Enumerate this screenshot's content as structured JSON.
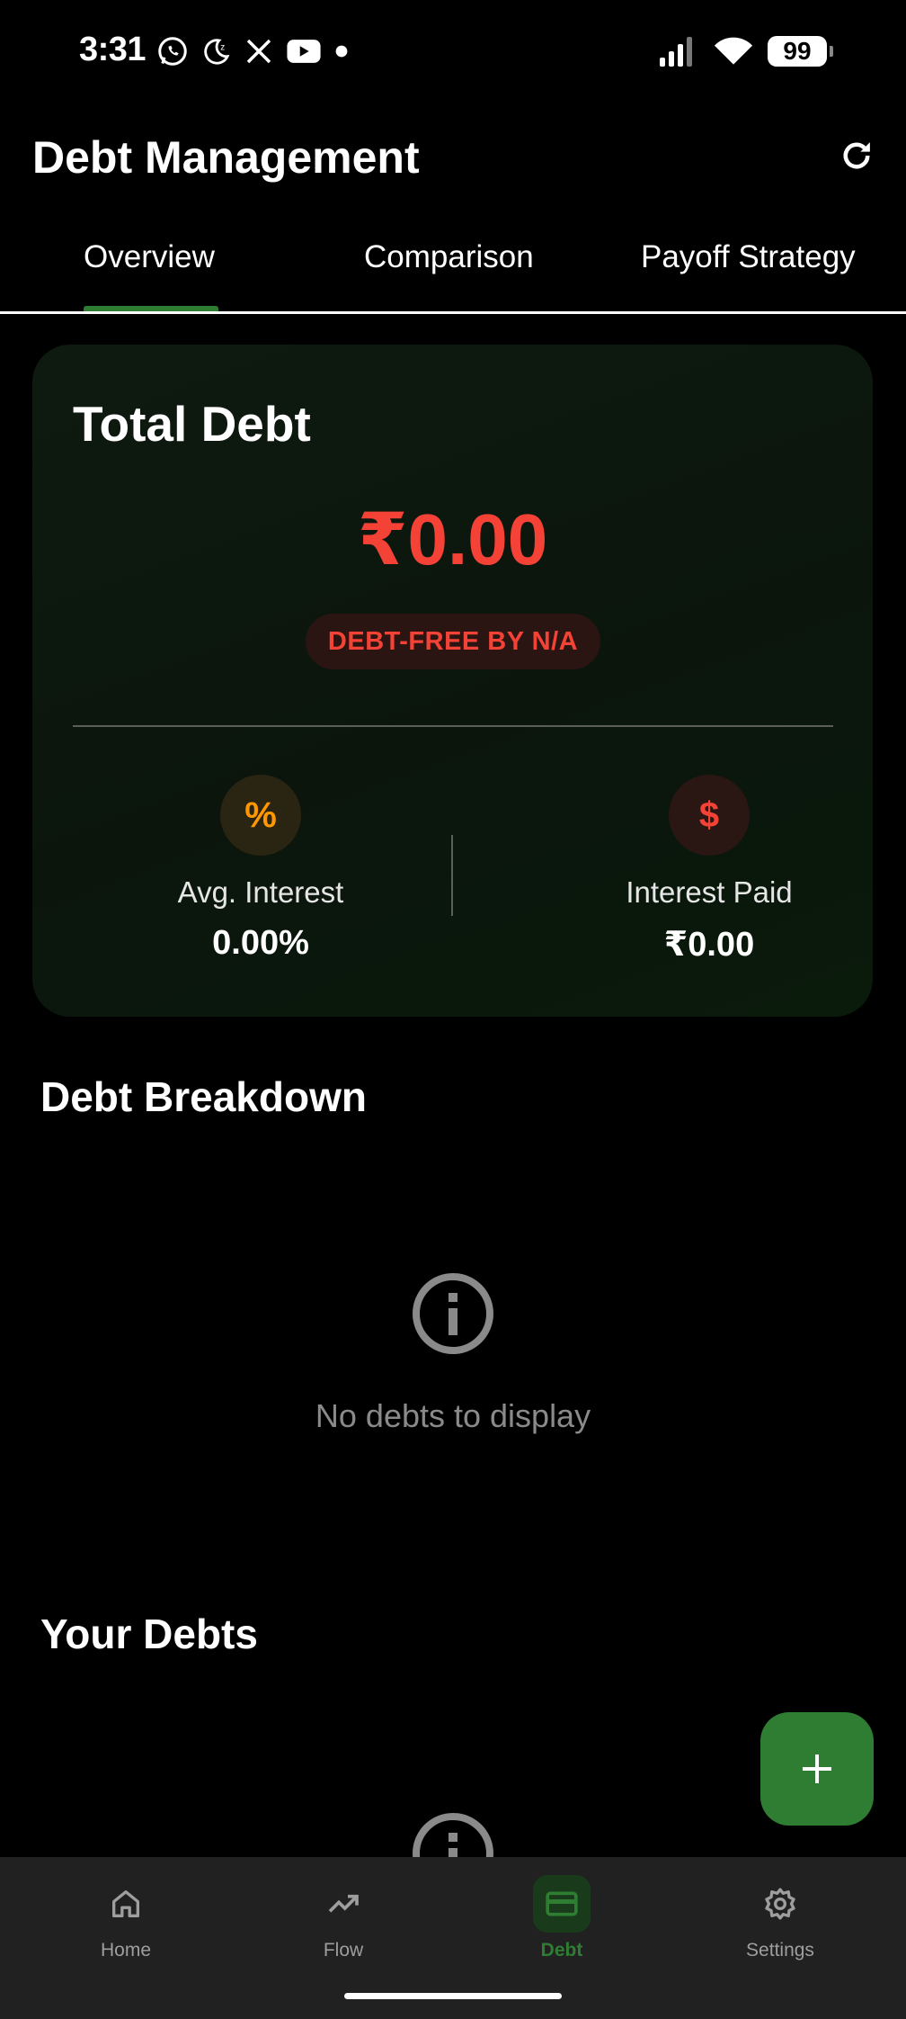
{
  "status_bar": {
    "time": "3:31",
    "battery": "99",
    "icons": [
      "whatsapp-icon",
      "do-not-disturb-icon",
      "x-icon",
      "youtube-icon",
      "dot-icon",
      "signal-icon",
      "wifi-icon",
      "battery-icon"
    ]
  },
  "header": {
    "title": "Debt Management",
    "refresh_icon": "refresh-icon"
  },
  "tabs": [
    {
      "label": "Overview",
      "active": true
    },
    {
      "label": "Comparison",
      "active": false
    },
    {
      "label": "Payoff Strategy",
      "active": false
    }
  ],
  "summary": {
    "title": "Total Debt",
    "total": "₹0.00",
    "badge": "DEBT-FREE BY N/A",
    "avg_interest": {
      "label": "Avg. Interest",
      "value": "0.00%",
      "icon": "%"
    },
    "interest_paid": {
      "label": "Interest Paid",
      "value": "₹0.00",
      "icon": "$"
    }
  },
  "breakdown": {
    "title": "Debt Breakdown",
    "empty_text": "No debts to display"
  },
  "your_debts": {
    "title": "Your Debts"
  },
  "fab": {
    "icon": "plus-icon"
  },
  "bottom_nav": [
    {
      "label": "Home",
      "icon": "home-icon",
      "active": false
    },
    {
      "label": "Flow",
      "icon": "trending-up-icon",
      "active": false
    },
    {
      "label": "Debt",
      "icon": "credit-card-icon",
      "active": true
    },
    {
      "label": "Settings",
      "icon": "gear-icon",
      "active": false
    }
  ],
  "colors": {
    "accent_green": "#2e7d32",
    "debt_red": "#f44336",
    "interest_orange": "#ff9800",
    "background": "#000000",
    "nav_background": "#212121"
  }
}
